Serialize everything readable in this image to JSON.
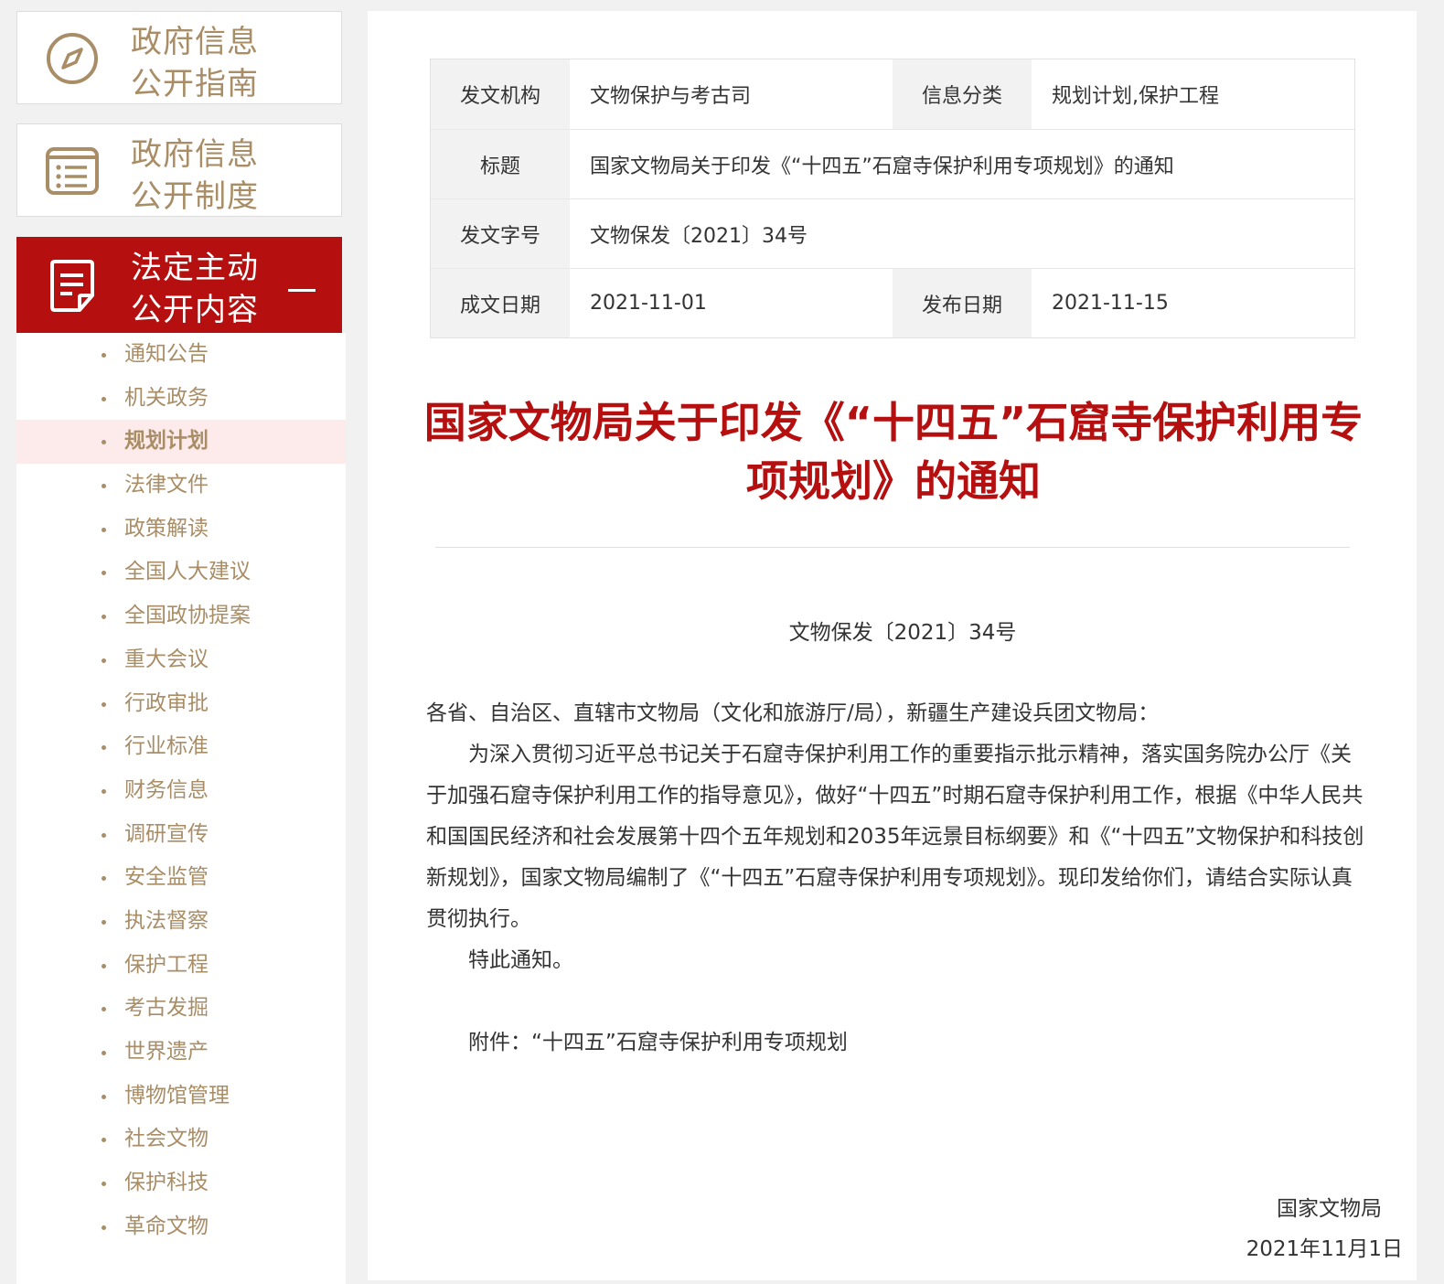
{
  "sidebar": {
    "guide_label_1": "政府信息",
    "guide_label_2": "公开指南",
    "system_label_1": "政府信息",
    "system_label_2": "公开制度",
    "active_label_1": "法定主动",
    "active_label_2": "公开内容",
    "items": [
      {
        "label": "通知公告"
      },
      {
        "label": "机关政务"
      },
      {
        "label": "规划计划"
      },
      {
        "label": "法律文件"
      },
      {
        "label": "政策解读"
      },
      {
        "label": "全国人大建议"
      },
      {
        "label": "全国政协提案"
      },
      {
        "label": "重大会议"
      },
      {
        "label": "行政审批"
      },
      {
        "label": "行业标准"
      },
      {
        "label": "财务信息"
      },
      {
        "label": "调研宣传"
      },
      {
        "label": "安全监管"
      },
      {
        "label": "执法督察"
      },
      {
        "label": "保护工程"
      },
      {
        "label": "考古发掘"
      },
      {
        "label": "世界遗产"
      },
      {
        "label": "博物馆管理"
      },
      {
        "label": "社会文物"
      },
      {
        "label": "保护科技"
      },
      {
        "label": "革命文物"
      }
    ],
    "current_item": "规划计划"
  },
  "meta": {
    "issuer_label": "发文机构",
    "issuer": "文物保护与考古司",
    "category_label": "信息分类",
    "category": "规划计划,保护工程",
    "title_label": "标题",
    "title": "国家文物局关于印发《“十四五”石窟寺保护利用专项规划》的通知",
    "docno_label": "发文字号",
    "docno": "文物保发〔2021〕34号",
    "written_label": "成文日期",
    "written": "2021-11-01",
    "published_label": "发布日期",
    "published": "2021-11-15"
  },
  "document": {
    "title": "国家文物局关于印发《“十四五”石窟寺保护利用专项规划》的通知",
    "number": "文物保发〔2021〕34号",
    "salutation": "各省、自治区、直辖市文物局（文化和旅游厅/局），新疆生产建设兵团文物局：",
    "paragraph": "为深入贯彻习近平总书记关于石窟寺保护利用工作的重要指示批示精神，落实国务院办公厅《关于加强石窟寺保护利用工作的指导意见》，做好“十四五”时期石窟寺保护利用工作，根据《中华人民共和国国民经济和社会发展第十四个五年规划和2035年远景目标纲要》和《“十四五”文物保护和科技创新规划》，国家文物局编制了《“十四五”石窟寺保护利用专项规划》。现印发给你们，请结合实际认真贯彻执行。",
    "closing": "特此通知。",
    "attachment": "附件：“十四五”石窟寺保护利用专项规划",
    "signature": "国家文物局",
    "date": "2021年11月1日"
  },
  "colors": {
    "accent": "#b50f0f",
    "sidebar_text": "#a88d66",
    "current_bg": "#fdeaea"
  }
}
